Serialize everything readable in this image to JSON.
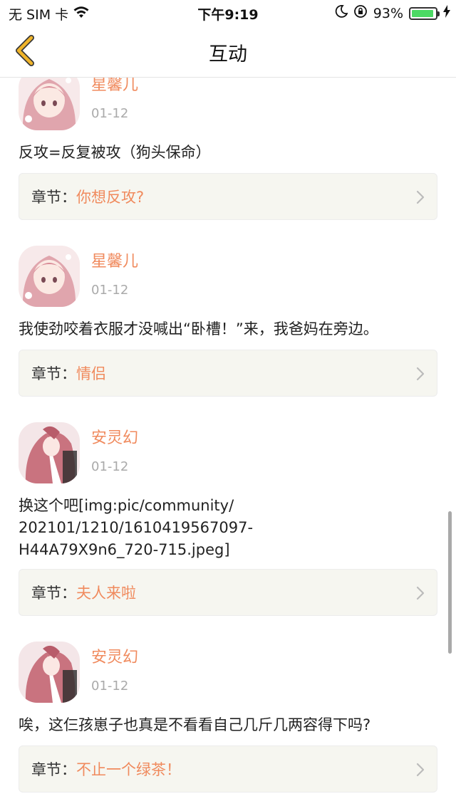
{
  "status_bar": {
    "carrier": "无 SIM 卡",
    "time": "下午9:19",
    "battery": "93%",
    "battery_level": 0.93,
    "battery_color": "#4cd964"
  },
  "nav": {
    "title": "互动",
    "back_icon": "chevron-left-icon",
    "accent": "#f0b429"
  },
  "chapter_label": "章节：",
  "colors": {
    "username": "#f08a5d",
    "chapter_name": "#f08a5d",
    "date": "#aaaaaa"
  },
  "comments": [
    {
      "user": "星馨儿",
      "date": "01-12",
      "text": "反攻=反复被攻（狗头保命）",
      "chapter": "你想反攻?"
    },
    {
      "user": "星馨儿",
      "date": "01-12",
      "text": "我使劲咬着衣服才没喊出“卧槽！”来，我爸妈在旁边。",
      "chapter": "情侣"
    },
    {
      "user": "安灵幻",
      "date": "01-12",
      "text": "换这个吧[img:pic/community/\n202101/1210/1610419567097-\nH44A79X9n6_720-715.jpeg]",
      "chapter": "夫人来啦"
    },
    {
      "user": "安灵幻",
      "date": "01-12",
      "text": "唉，这仨孩崽子也真是不看看自己几斤几两容得下吗?",
      "chapter": "不止一个绿茶！"
    }
  ]
}
